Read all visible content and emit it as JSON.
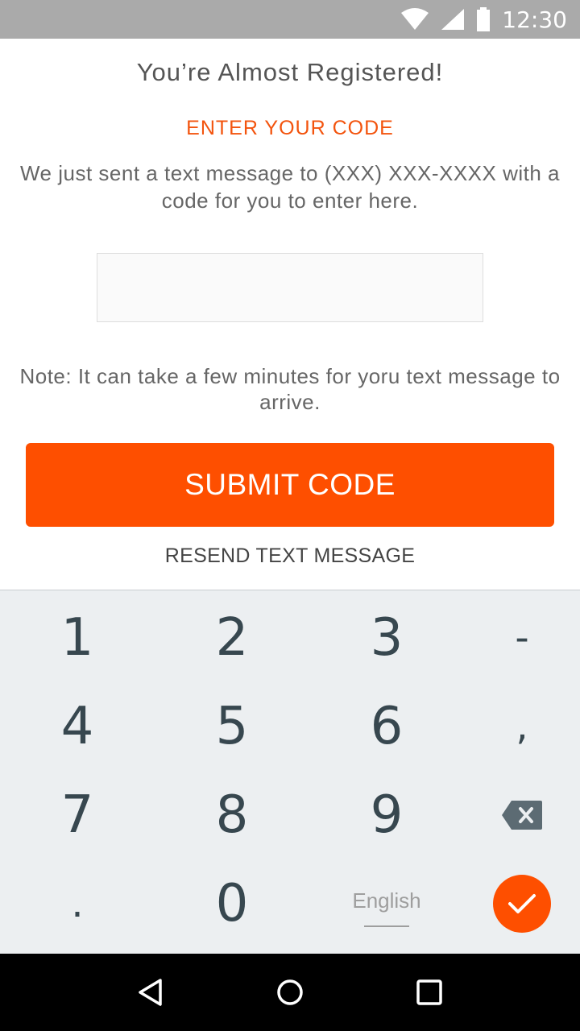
{
  "status_bar": {
    "time": "12:30",
    "icons": [
      "wifi-icon",
      "cell-signal-icon",
      "battery-icon"
    ]
  },
  "screen": {
    "title": "You’re Almost Registered!",
    "subtitle": "ENTER YOUR CODE",
    "description": "We just sent a text message to (XXX) XXX-XXXX with a code for you to enter here.",
    "code_input": {
      "value": "",
      "placeholder": ""
    },
    "note": "Note: It can take a few minutes for yoru text message to arrive.",
    "submit_label": "SUBMIT CODE",
    "resend_label": "RESEND TEXT MESSAGE"
  },
  "keyboard": {
    "keys": {
      "k1": "1",
      "k2": "2",
      "k3": "3",
      "dash": "-",
      "k4": "4",
      "k5": "5",
      "k6": "6",
      "comma": ",",
      "k7": "7",
      "k8": "8",
      "k9": "9",
      "period": ".",
      "k0": "0",
      "language": "English"
    },
    "icons": [
      "backspace-icon",
      "checkmark-icon"
    ]
  },
  "nav_bar": {
    "icons": [
      "back-icon",
      "home-icon",
      "recents-icon"
    ]
  },
  "colors": {
    "accent": "#fe4f00",
    "subtitle": "#f3540e",
    "status_bar": "#aaaaaa",
    "keyboard_bg": "#eceff1",
    "key_text": "#37474f"
  }
}
